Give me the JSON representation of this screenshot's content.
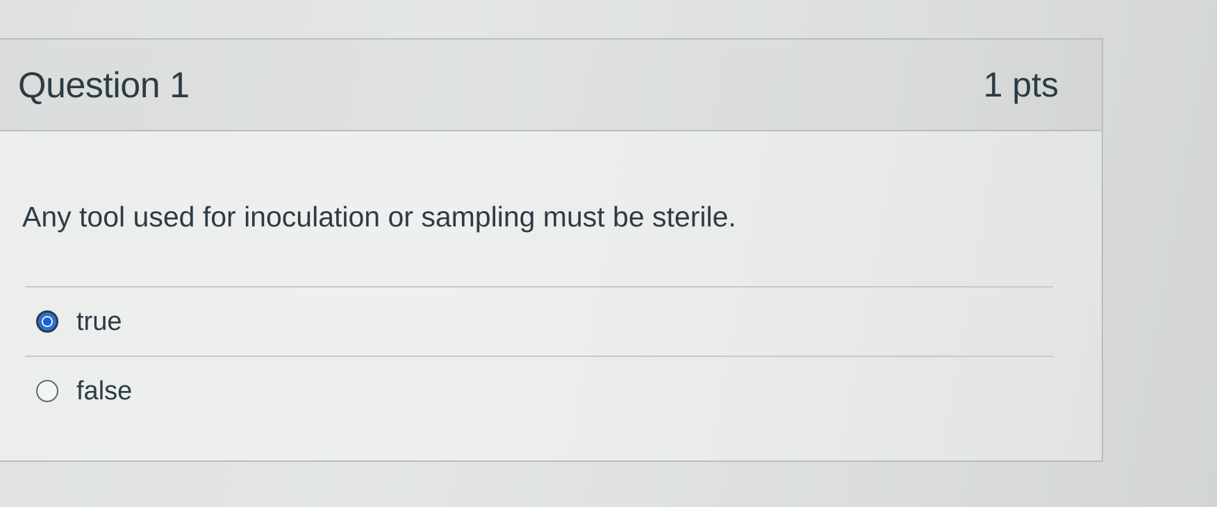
{
  "question": {
    "title": "Question 1",
    "points": "1 pts",
    "text": "Any tool used for inoculation or sampling must be sterile."
  },
  "answers": [
    {
      "label": "true",
      "selected": true
    },
    {
      "label": "false",
      "selected": false
    }
  ],
  "colors": {
    "text": "#2d3b45",
    "radio_selected": "#2d6fd8",
    "header_bg": "#dcdfde",
    "card_bg": "#eceeed"
  }
}
